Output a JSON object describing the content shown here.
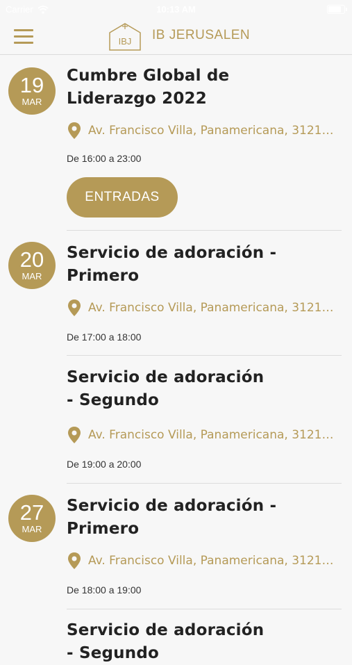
{
  "status_bar": {
    "carrier": "Carrier",
    "time": "10:13 AM"
  },
  "header": {
    "logo_initials": "IBJ",
    "brand_name": "IB JERUSALEN"
  },
  "colors": {
    "accent": "#b59a57",
    "background": "#f7f7f7",
    "divider": "#dcdcdc",
    "text": "#222222"
  },
  "icons": {
    "menu": "hamburger-menu-icon",
    "location": "map-pin-icon",
    "wifi": "wifi-icon",
    "battery": "battery-icon",
    "battery_level": 0.9
  },
  "events": [
    {
      "day": "19",
      "month": "MAR",
      "title": "Cumbre Global de Liderazgo 2022",
      "address": "Av. Francisco Villa, Panamericana, 31210...",
      "time_range": "De 16:00 a 23:00",
      "button_label": "ENTRADAS"
    },
    {
      "day": "20",
      "month": "MAR",
      "title": "Servicio de adoración - Primero",
      "address": "Av. Francisco Villa, Panamericana, 31210...",
      "time_range": "De 17:00 a 18:00"
    },
    {
      "title": "Servicio de adoración - Segundo",
      "address": "Av. Francisco Villa, Panamericana, 31210...",
      "time_range": "De 19:00 a 20:00"
    },
    {
      "day": "27",
      "month": "MAR",
      "title": "Servicio de adoración - Primero",
      "address": "Av. Francisco Villa, Panamericana, 31210...",
      "time_range": "De 18:00 a 19:00"
    },
    {
      "title": "Servicio de adoración - Segundo"
    }
  ]
}
